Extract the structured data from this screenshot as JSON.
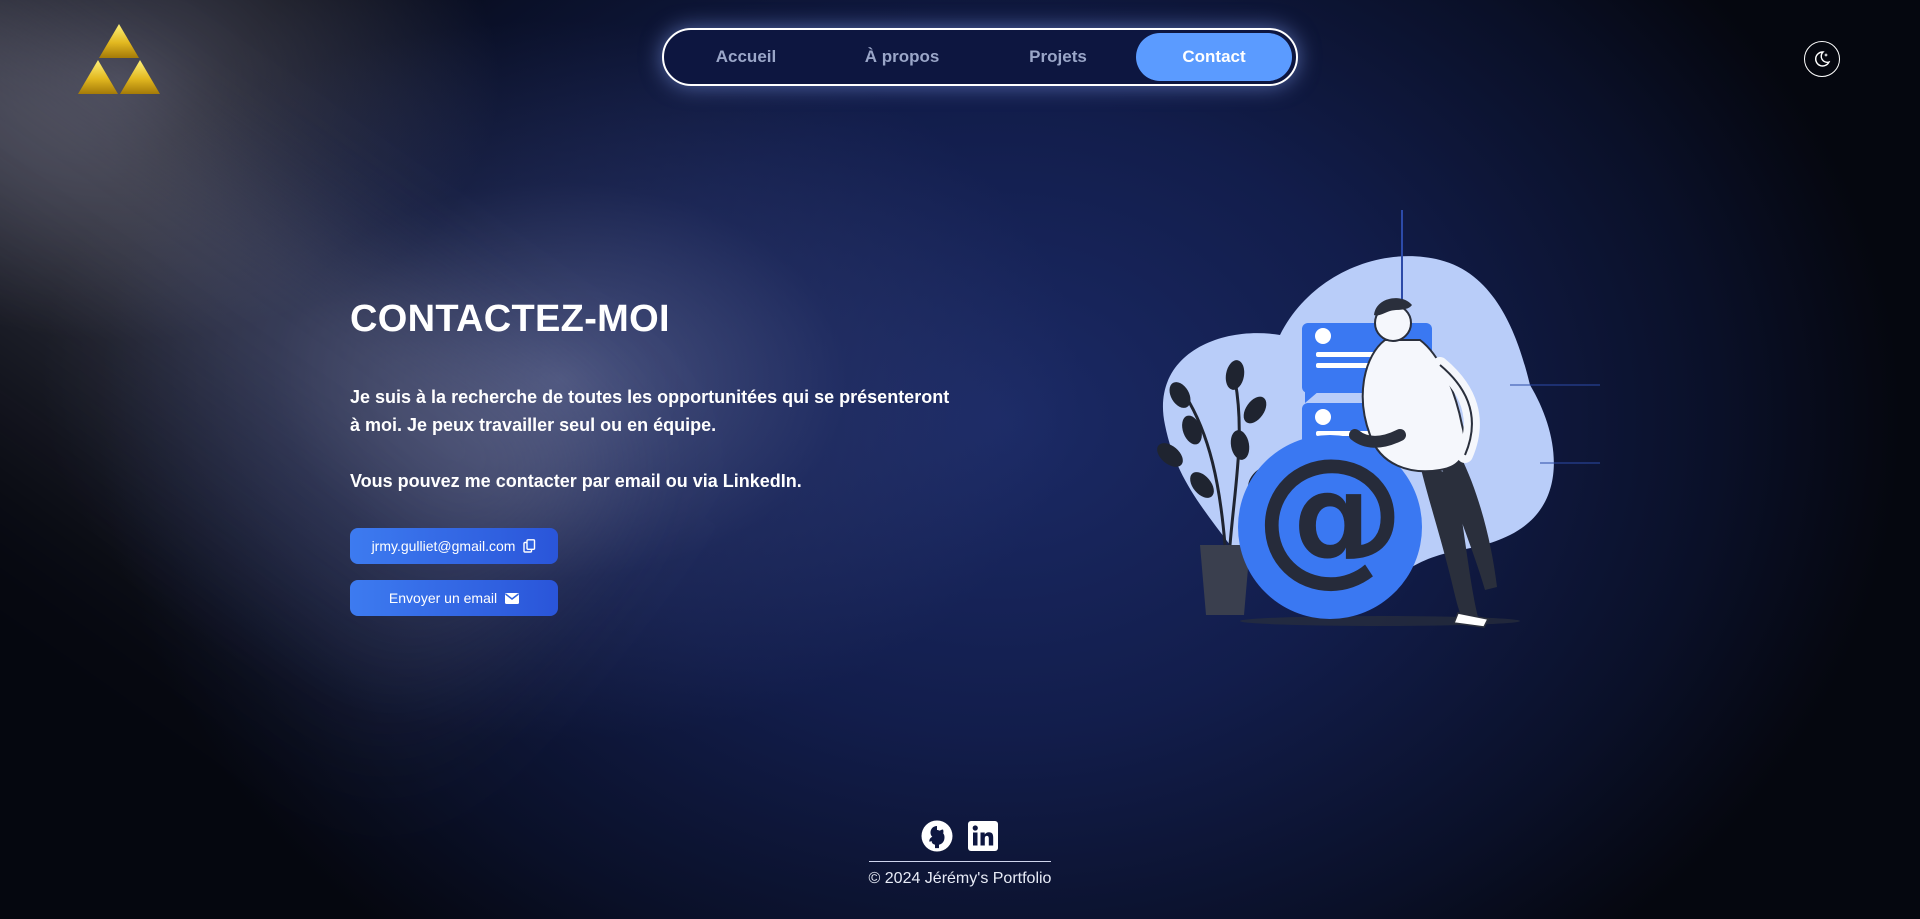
{
  "logo": {
    "icon": "triforce-icon"
  },
  "nav": {
    "items": [
      {
        "label": "Accueil",
        "active": false
      },
      {
        "label": "À propos",
        "active": false
      },
      {
        "label": "Projets",
        "active": false
      },
      {
        "label": "Contact",
        "active": true
      }
    ],
    "accent": "#5b9bff"
  },
  "theme_toggle": {
    "icon": "moon-sparkle-icon"
  },
  "contact": {
    "title": "CONTACTEZ-MOI",
    "paragraph1": "Je suis à la recherche de toutes les opportunitées qui se présenteront à moi. Je peux travailler seul ou en équipe.",
    "paragraph2": "Vous pouvez me contacter par email ou via LinkedIn.",
    "email_button": {
      "label": "jrmy.gulliet@gmail.com",
      "icon": "copy-icon"
    },
    "send_button": {
      "label": "Envoyer un email",
      "icon": "envelope-icon"
    }
  },
  "illustration": {
    "icon": "contact-at-illustration"
  },
  "footer": {
    "socials": [
      {
        "icon": "github-icon"
      },
      {
        "icon": "linkedin-icon"
      }
    ],
    "copyright": "© 2024 Jérémy's Portfolio"
  }
}
